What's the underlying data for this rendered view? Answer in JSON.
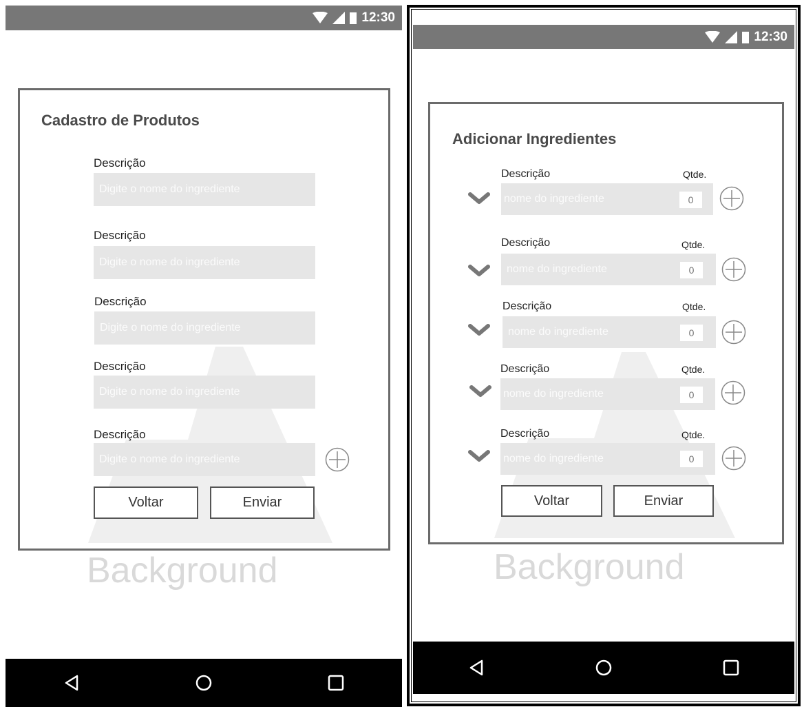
{
  "status_bar": {
    "time": "12:30"
  },
  "background_label": "Background",
  "screen1": {
    "title": "Cadastro de Produtos",
    "fields": [
      {
        "label": "Descrição",
        "placeholder": "Digite o nome do ingrediente"
      },
      {
        "label": "Descrição",
        "placeholder": "Digite o nome do ingrediente"
      },
      {
        "label": "Descrição",
        "placeholder": "Digite o nome do ingrediente"
      },
      {
        "label": "Descrição",
        "placeholder": "Digite o nome do ingrediente"
      },
      {
        "label": "Descrição",
        "placeholder": "Digite o nome do ingrediente"
      }
    ],
    "back_button": "Voltar",
    "send_button": "Enviar"
  },
  "screen2": {
    "title": "Adicionar Ingredientes",
    "rows": [
      {
        "label": "Descrição",
        "qty_label": "Qtde.",
        "placeholder": "nome do ingrediente",
        "qty_value": "0"
      },
      {
        "label": "Descrição",
        "qty_label": "Qtde.",
        "placeholder": "nome do ingrediente",
        "qty_value": "0"
      },
      {
        "label": "Descrição",
        "qty_label": "Qtde.",
        "placeholder": "nome do ingrediente",
        "qty_value": "0"
      },
      {
        "label": "Descrição",
        "qty_label": "Qtde.",
        "placeholder": "nome do ingrediente",
        "qty_value": "0"
      },
      {
        "label": "Descrição",
        "qty_label": "Qtde.",
        "placeholder": "nome do ingrediente",
        "qty_value": "0"
      }
    ],
    "back_button": "Voltar",
    "send_button": "Enviar"
  },
  "nav_icons": [
    "back-triangle-icon",
    "home-circle-icon",
    "recents-square-icon"
  ],
  "colors": {
    "status_bar": "#777777",
    "nav_bar": "#000000",
    "input_bg": "#e6e6e6",
    "card_border": "#6b6b6b"
  }
}
